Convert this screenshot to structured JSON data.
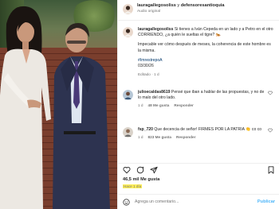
{
  "header": {
    "author": "lauragallegosoliss",
    "conjunction": "y",
    "coauthor": "defensoresantioquia",
    "audio": "Audio original"
  },
  "caption": {
    "username": "lauragallegosoliss",
    "text": "Si tienes a Iván Cepeda en un lado y a Petro en el otro CORRIENDO, ¿a quién le sueltas el tigre? 🐅",
    "text2": "Impecable ver cómo después de meses, la coherencia de este hombre es la misma.",
    "hashtag": "#ImrestrepoA",
    "date": "03/30/26",
    "meta": "Editado · 1 d"
  },
  "comments": [
    {
      "username": "julioecaldas8619",
      "text": "Pensé que iban a hablar de las propuestas, y no de lo malo del otro lado.",
      "time": "1 d",
      "likes": "48 Me gusta",
      "reply": "Responder"
    },
    {
      "username": "fsp_720",
      "text": "Que decencia de señor! FIRMES POR LA PATRIA 👏 co co",
      "time": "1 d",
      "likes": "823 Me gusta",
      "reply": "Responder"
    }
  ],
  "likes": "46,5 mil Me gusta",
  "time_ago": "Hace 1 día",
  "add_comment": {
    "placeholder": "Agrega un comentario...",
    "post_label": "Publicar"
  },
  "icons": {
    "like": "heart-icon",
    "comment": "comment-icon",
    "share": "share-icon",
    "save": "bookmark-icon",
    "emoji": "emoji-icon"
  },
  "colors": {
    "link": "#00376b",
    "post_button": "#4cb5f9",
    "highlight": "#ffec3c"
  }
}
